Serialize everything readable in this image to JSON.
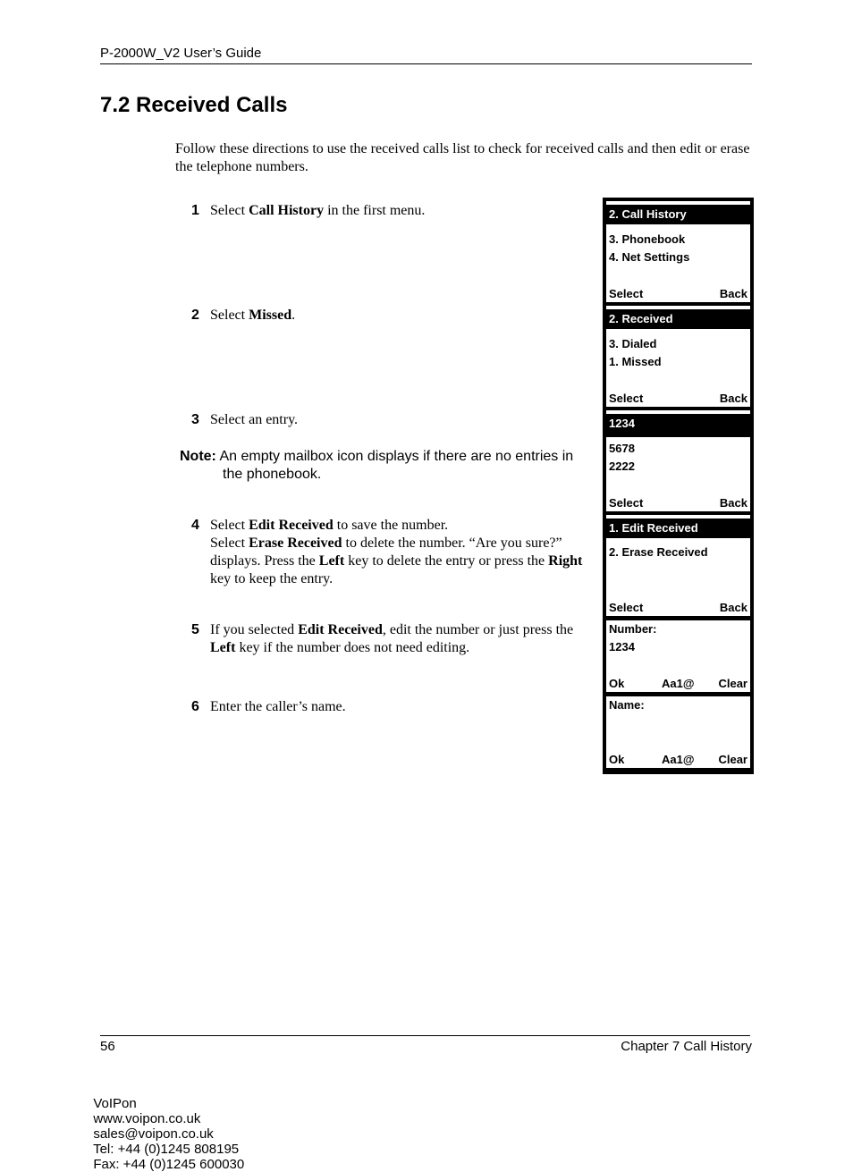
{
  "header": {
    "title": "P-2000W_V2 User’s Guide"
  },
  "section": {
    "title": "7.2  Received Calls"
  },
  "intro": "Follow these directions to use the received calls list to check for received calls and then edit or erase the telephone numbers.",
  "steps": [
    {
      "num": "1",
      "parts": [
        {
          "t": "Select "
        },
        {
          "b": "Call History"
        },
        {
          "t": " in the first menu."
        }
      ]
    },
    {
      "num": "2",
      "parts": [
        {
          "t": "Select "
        },
        {
          "b": "Missed"
        },
        {
          "t": "."
        }
      ]
    },
    {
      "num": "3",
      "parts": [
        {
          "t": "Select an entry."
        }
      ]
    },
    {
      "num": "4",
      "parts": [
        {
          "t": "Select "
        },
        {
          "b": "Edit Received"
        },
        {
          "t": " to save the number."
        },
        {
          "br": true
        },
        {
          "t": "Select "
        },
        {
          "b": "Erase Received"
        },
        {
          "t": " to delete the number. “Are you sure?” displays. Press the "
        },
        {
          "b": "Left"
        },
        {
          "t": " key to delete the entry or press the "
        },
        {
          "b": "Right"
        },
        {
          "t": " key to keep the entry."
        }
      ]
    },
    {
      "num": "5",
      "parts": [
        {
          "t": "If you selected "
        },
        {
          "b": "Edit Received"
        },
        {
          "t": ", edit the number or just press the "
        },
        {
          "b": "Left"
        },
        {
          "t": " key if the number does not need editing."
        }
      ]
    },
    {
      "num": "6",
      "parts": [
        {
          "t": "Enter the caller’s name."
        }
      ]
    }
  ],
  "note": {
    "label": "Note:",
    "text1": "An empty mailbox icon displays if there are no entries in",
    "text2": "the phonebook."
  },
  "screens": [
    {
      "highlight": "2. Call History",
      "items": [
        "3. Phonebook",
        "4. Net Settings"
      ],
      "softkeys": {
        "left": "Select",
        "right": "Back"
      }
    },
    {
      "highlight": "2. Received",
      "items": [
        "3. Dialed",
        "1. Missed"
      ],
      "softkeys": {
        "left": "Select",
        "right": "Back"
      }
    },
    {
      "highlight": "1234",
      "items": [
        "5678",
        "2222"
      ],
      "softkeys": {
        "left": "Select",
        "right": "Back"
      }
    },
    {
      "highlight": "1. Edit Received",
      "items": [
        "2. Erase Received"
      ],
      "softkeys": {
        "left": "Select",
        "right": "Back"
      }
    },
    {
      "items": [
        "Number:",
        "1234"
      ],
      "softkeys": {
        "left": "Ok",
        "middle": "Aa1@",
        "right": "Clear"
      }
    },
    {
      "items": [
        "Name:"
      ],
      "softkeys": {
        "left": "Ok",
        "middle": "Aa1@",
        "right": "Clear"
      }
    }
  ],
  "footer": {
    "page": "56",
    "chapter": "Chapter 7 Call History",
    "contact": [
      "VoIPon",
      "www.voipon.co.uk",
      "sales@voipon.co.uk",
      "Tel: +44 (0)1245 808195",
      "Fax: +44 (0)1245 600030"
    ]
  }
}
